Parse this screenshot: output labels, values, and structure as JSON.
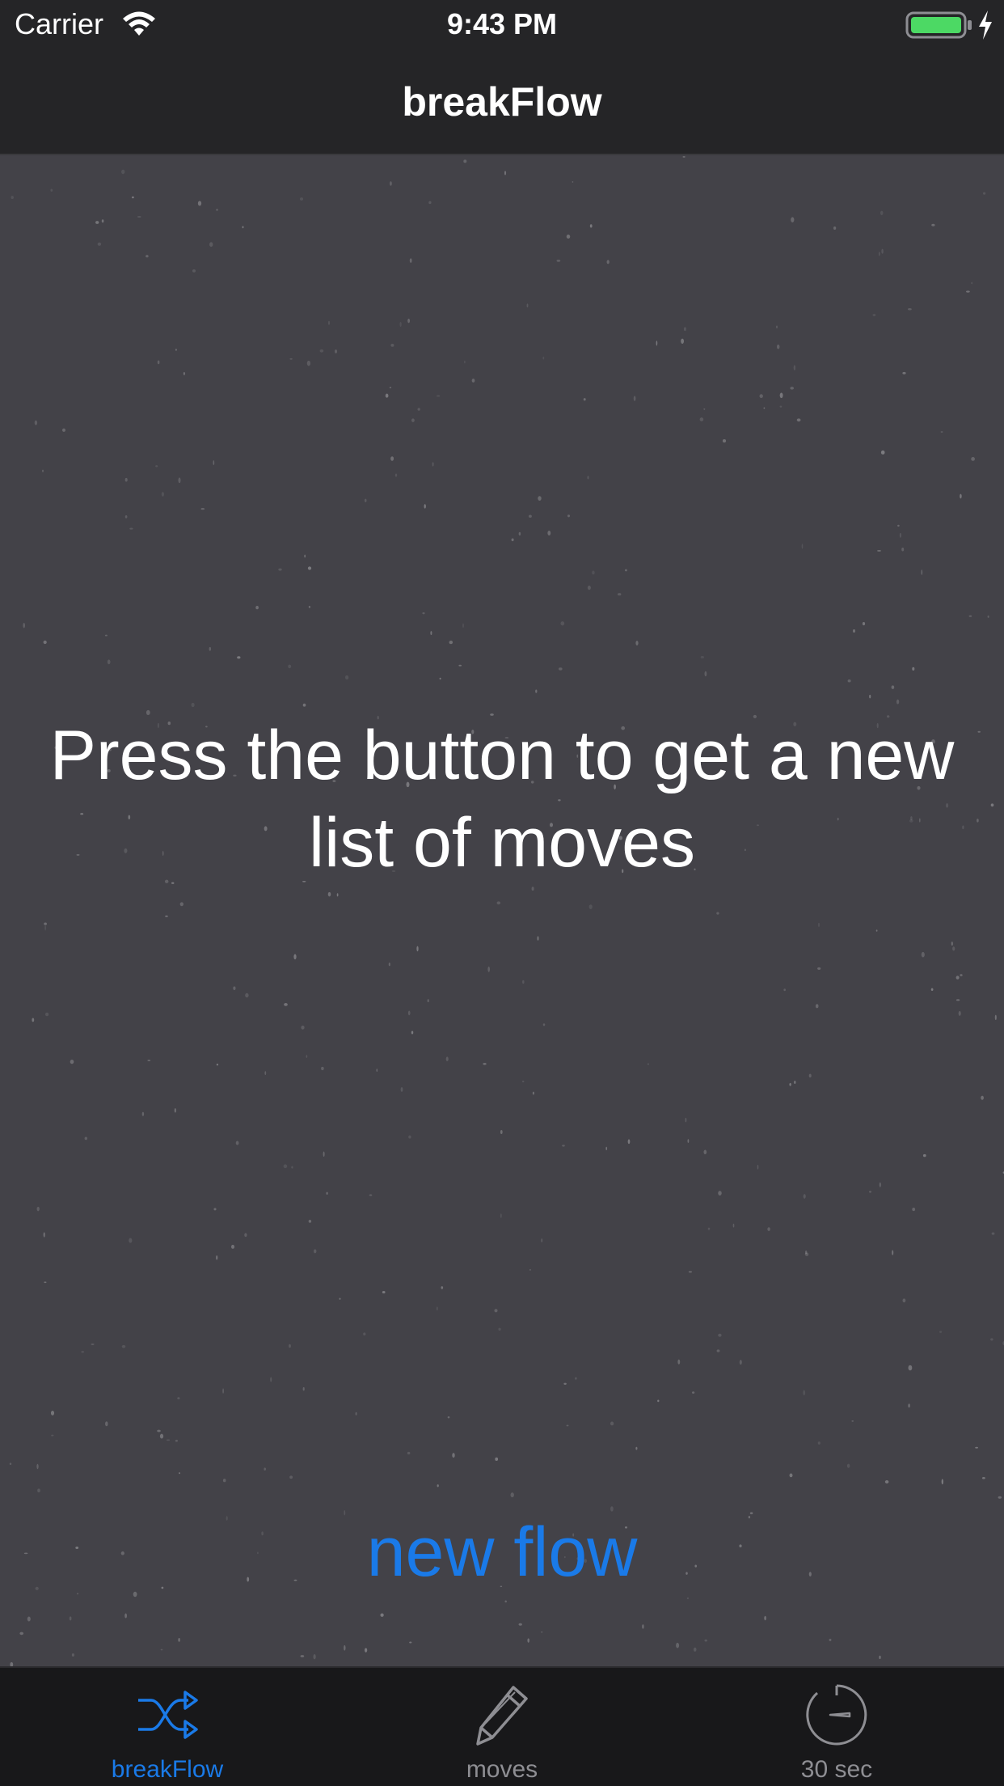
{
  "status_bar": {
    "carrier": "Carrier",
    "time": "9:43 PM",
    "battery_color": "#4cd964"
  },
  "nav_bar": {
    "title": "breakFlow"
  },
  "main": {
    "prompt": "Press the button to get a new list of moves",
    "button_label": "new flow",
    "background_color": "#434248",
    "accent_color": "#1a7ae8"
  },
  "tab_bar": {
    "items": [
      {
        "label": "breakFlow",
        "icon": "shuffle-icon",
        "active": true
      },
      {
        "label": "moves",
        "icon": "pencil-icon",
        "active": false
      },
      {
        "label": "30 sec",
        "icon": "timer-icon",
        "active": false
      }
    ]
  }
}
